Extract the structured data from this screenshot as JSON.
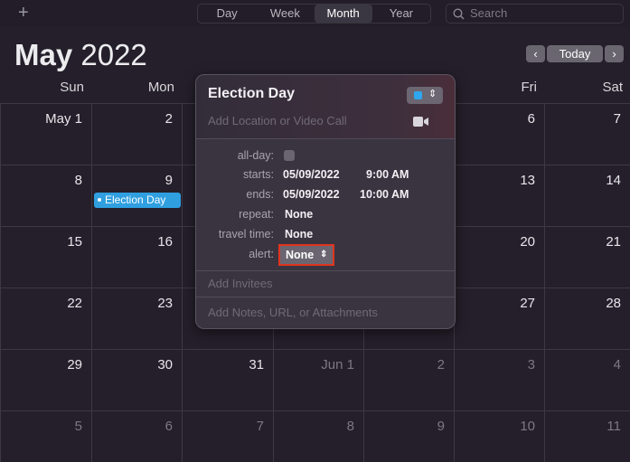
{
  "toolbar": {
    "add_icon": "+",
    "views": [
      "Day",
      "Week",
      "Month",
      "Year"
    ],
    "selected_view": "Month",
    "search_placeholder": "Search"
  },
  "header": {
    "month": "May",
    "year": "2022",
    "today_label": "Today",
    "prev_icon": "‹",
    "next_icon": "›"
  },
  "weekdays": [
    "Sun",
    "Mon",
    "",
    "",
    "",
    "Fri",
    "Sat"
  ],
  "weeks": [
    [
      {
        "d": "May 1"
      },
      {
        "d": "2"
      },
      {
        "d": ""
      },
      {
        "d": ""
      },
      {
        "d": ""
      },
      {
        "d": "6"
      },
      {
        "d": "7"
      }
    ],
    [
      {
        "d": "8"
      },
      {
        "d": "9"
      },
      {
        "d": ""
      },
      {
        "d": ""
      },
      {
        "d": ""
      },
      {
        "d": "13"
      },
      {
        "d": "14"
      }
    ],
    [
      {
        "d": "15"
      },
      {
        "d": "16"
      },
      {
        "d": ""
      },
      {
        "d": ""
      },
      {
        "d": ""
      },
      {
        "d": "20"
      },
      {
        "d": "21"
      }
    ],
    [
      {
        "d": "22"
      },
      {
        "d": "23"
      },
      {
        "d": ""
      },
      {
        "d": ""
      },
      {
        "d": ""
      },
      {
        "d": "27"
      },
      {
        "d": "28"
      }
    ],
    [
      {
        "d": "29"
      },
      {
        "d": "30"
      },
      {
        "d": "31"
      },
      {
        "d": "Jun 1",
        "dim": true
      },
      {
        "d": "2",
        "dim": true
      },
      {
        "d": "3",
        "dim": true
      },
      {
        "d": "4",
        "dim": true
      }
    ],
    [
      {
        "d": "5",
        "dim": true
      },
      {
        "d": "6",
        "dim": true
      },
      {
        "d": "7",
        "dim": true
      },
      {
        "d": "8",
        "dim": true
      },
      {
        "d": "9",
        "dim": true
      },
      {
        "d": "10",
        "dim": true
      },
      {
        "d": "11",
        "dim": true
      }
    ]
  ],
  "event": {
    "title": "Election Day",
    "color": "#2f9fe0"
  },
  "popover": {
    "title": "Election Day",
    "location_placeholder": "Add Location or Video Call",
    "fields": {
      "allday_label": "all-day:",
      "starts_label": "starts:",
      "starts_date": "05/09/2022",
      "starts_time": "9:00 AM",
      "ends_label": "ends:",
      "ends_date": "05/09/2022",
      "ends_time": "10:00 AM",
      "repeat_label": "repeat:",
      "repeat": "None",
      "travel_label": "travel time:",
      "travel": "None",
      "alert_label": "alert:",
      "alert": "None"
    },
    "invitees_placeholder": "Add Invitees",
    "notes_placeholder": "Add Notes, URL, or Attachments",
    "highlight_color": "#e0341f"
  }
}
